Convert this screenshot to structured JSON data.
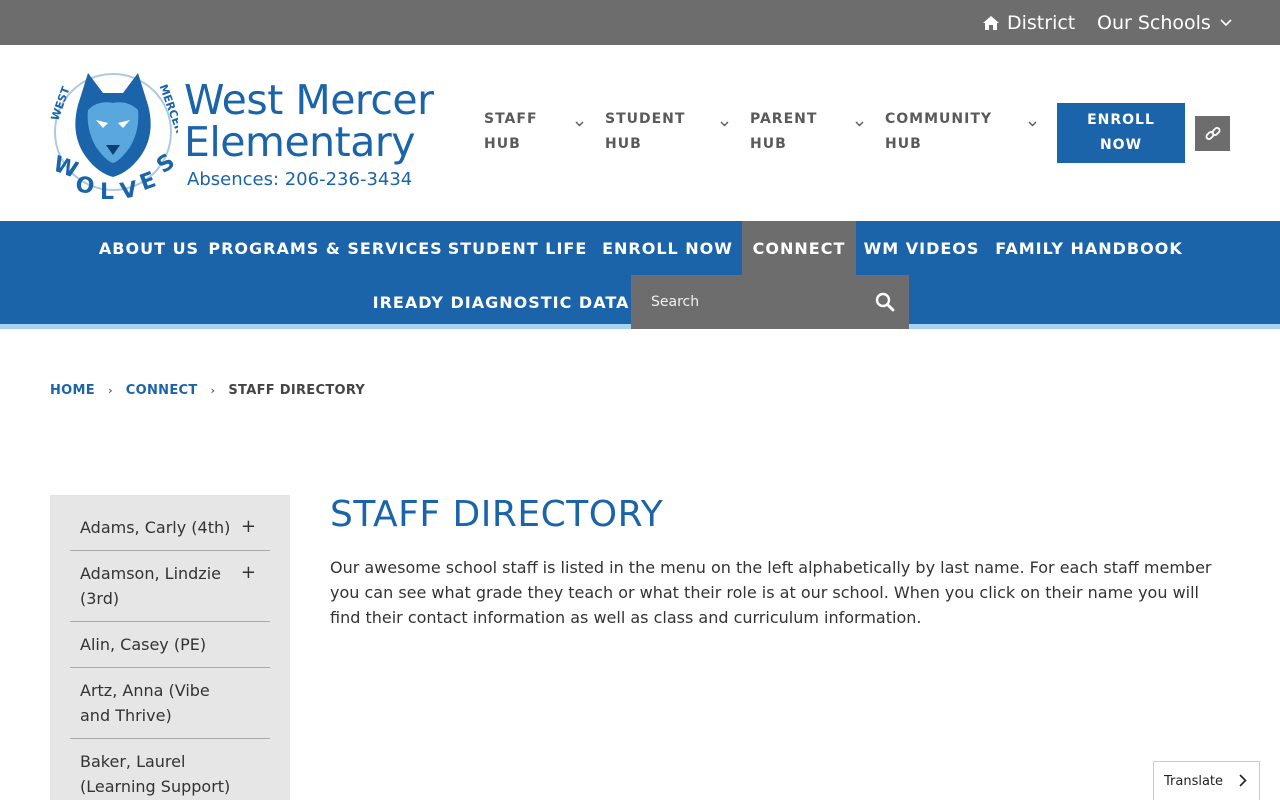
{
  "utility": {
    "district": "District",
    "our_schools": "Our Schools"
  },
  "header": {
    "school_name": "West Mercer Elementary",
    "absences": "Absences: 206-236-3434",
    "logo_text": "WEST MERCER WOLVES",
    "hubs": [
      {
        "label": "STAFF\nHUB"
      },
      {
        "label": "STUDENT\nHUB"
      },
      {
        "label": "PARENT\nHUB"
      },
      {
        "label": "COMMUNITY\nHUB"
      }
    ],
    "enroll_label": "ENROLL\nNOW"
  },
  "nav": {
    "items": [
      {
        "label": "ABOUT US"
      },
      {
        "label": "PROGRAMS & SERVICES"
      },
      {
        "label": "STUDENT LIFE"
      },
      {
        "label": "ENROLL NOW"
      },
      {
        "label": "CONNECT"
      },
      {
        "label": "WM VIDEOS"
      },
      {
        "label": "FAMILY HANDBOOK"
      },
      {
        "label": "IREADY DIAGNOSTIC DATA"
      }
    ],
    "active": "CONNECT",
    "search_placeholder": "Search"
  },
  "breadcrumb": {
    "home": "HOME",
    "connect": "CONNECT",
    "current": "STAFF DIRECTORY"
  },
  "sidebar": {
    "items": [
      {
        "label": "Adams, Carly (4th)",
        "expand": "+"
      },
      {
        "label": "Adamson, Lindzie (3rd)",
        "expand": "+"
      },
      {
        "label": "Alin, Casey (PE)"
      },
      {
        "label": "Artz, Anna (Vibe and Thrive)"
      },
      {
        "label": "Baker, Laurel (Learning Support)"
      }
    ]
  },
  "content": {
    "title": "STAFF DIRECTORY",
    "intro": "Our awesome school staff is listed in the menu on the left alphabetically by last name. For each staff member you can see what grade they teach or what their role is at our school. When you click on their name you will find their contact information as well as class and curriculum information."
  },
  "translate": {
    "label": "Translate"
  },
  "colors": {
    "brand_blue": "#1b64aa",
    "utility_gray": "#6d6d6d",
    "nav_underline": "#a9d1f0",
    "sidebar_bg": "#e6e6e6"
  }
}
